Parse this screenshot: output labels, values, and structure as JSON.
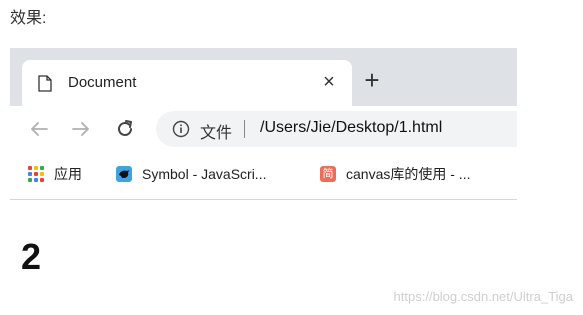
{
  "caption": "效果:",
  "browser": {
    "tab": {
      "title": "Document",
      "close_symbol": "×",
      "page_icon": "document-icon"
    },
    "new_tab_symbol": "+",
    "toolbar": {
      "back_icon": "arrow-left-icon",
      "forward_icon": "arrow-right-icon",
      "reload_icon": "reload-icon",
      "info_icon": "info-icon",
      "file_label": "文件",
      "url": "/Users/Jie/Desktop/1.html"
    },
    "bookmarks": [
      {
        "label": "应用",
        "icon": "apps-grid-icon"
      },
      {
        "label": "Symbol - JavaScri...",
        "icon": "symbol-favicon"
      },
      {
        "label": "canvas库的使用 - ...",
        "icon": "jian-favicon",
        "icon_text": "简"
      }
    ]
  },
  "page": {
    "content": "2"
  },
  "watermark": "https://blog.csdn.net/Ultra_Tiga",
  "colors": {
    "tabstrip": "#dee1e6",
    "omnibox": "#f1f3f4",
    "symbol_favicon": "#3fa3e0",
    "jian_favicon": "#e8705a"
  }
}
